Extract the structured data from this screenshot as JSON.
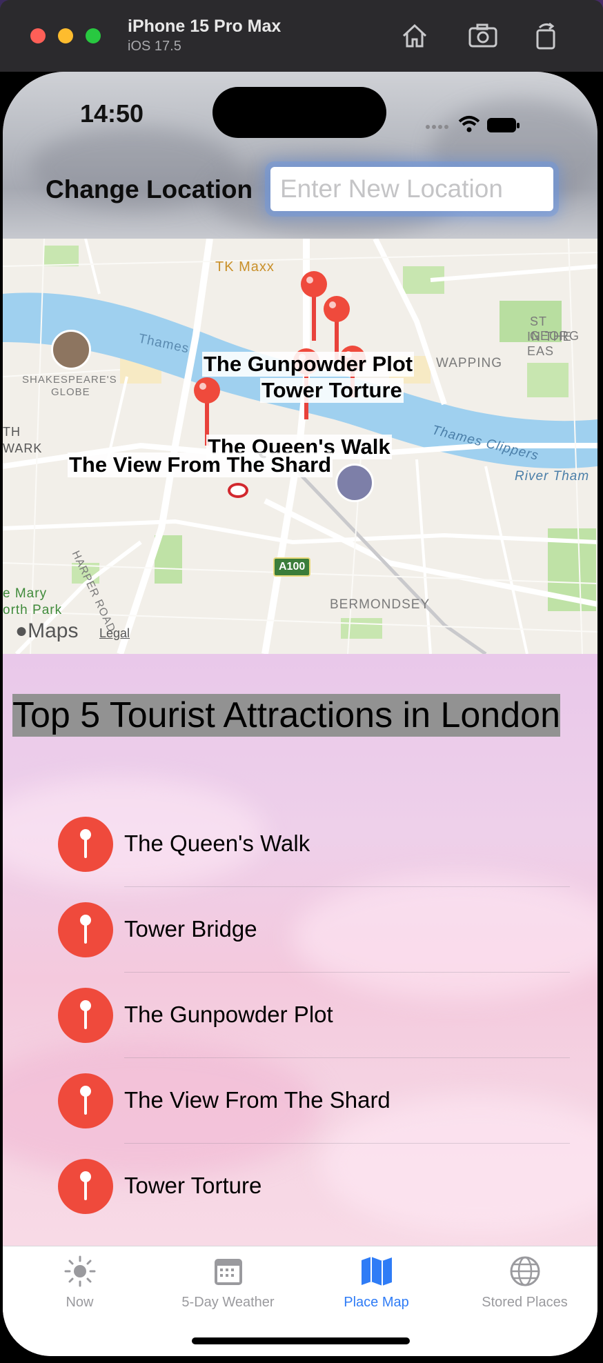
{
  "window": {
    "device_name": "iPhone 15 Pro Max",
    "os_version": "iOS 17.5",
    "toolbar_icons": [
      "home-icon",
      "screenshot-camera-icon",
      "rotate-icon"
    ]
  },
  "status_bar": {
    "time": "14:50"
  },
  "header": {
    "change_location_label": "Change Location",
    "location_placeholder": "Enter New Location",
    "location_value": ""
  },
  "map": {
    "pins": [
      {
        "label": "The Gunpowder Plot"
      },
      {
        "label": "Tower Torture"
      },
      {
        "label": "The Queen's Walk"
      },
      {
        "label": "The View From The Shard"
      }
    ],
    "place_labels": {
      "tk_maxx": "TK Maxx",
      "thames": "Thames",
      "shakespeares_globe_1": "SHAKESPEARE'S",
      "shakespeares_globe_2": "GLOBE",
      "wapping": "WAPPING",
      "st_george_1": "ST GEORG",
      "st_george_2": "IN THE EAS",
      "southwark_1": "TH",
      "southwark_2": "WARK",
      "thames_clippers": "Thames Clippers",
      "river_thames": "River Tham",
      "harper_road": "HARPER ROAD",
      "a100": "A100",
      "bermondsey": "BERMONDSEY",
      "st_mary_1": "e Mary",
      "st_mary_2": "orth Park"
    },
    "attribution": "Maps",
    "legal": "Legal"
  },
  "attractions": {
    "title": "Top 5 Tourist Attractions in London",
    "items": [
      {
        "name": "The Queen's Walk"
      },
      {
        "name": "Tower Bridge"
      },
      {
        "name": "The Gunpowder Plot"
      },
      {
        "name": "The View From The Shard"
      },
      {
        "name": "Tower Torture"
      }
    ]
  },
  "tabbar": {
    "tabs": [
      {
        "label": "Now",
        "icon": "sun-icon"
      },
      {
        "label": "5-Day Weather",
        "icon": "calendar-icon"
      },
      {
        "label": "Place Map",
        "icon": "map-icon",
        "active": true
      },
      {
        "label": "Stored Places",
        "icon": "globe-icon"
      }
    ]
  },
  "colors": {
    "pin_red": "#ef4a3c",
    "active_tab_blue": "#2f7cf6",
    "inactive_tab_gray": "#9a9a9e"
  }
}
